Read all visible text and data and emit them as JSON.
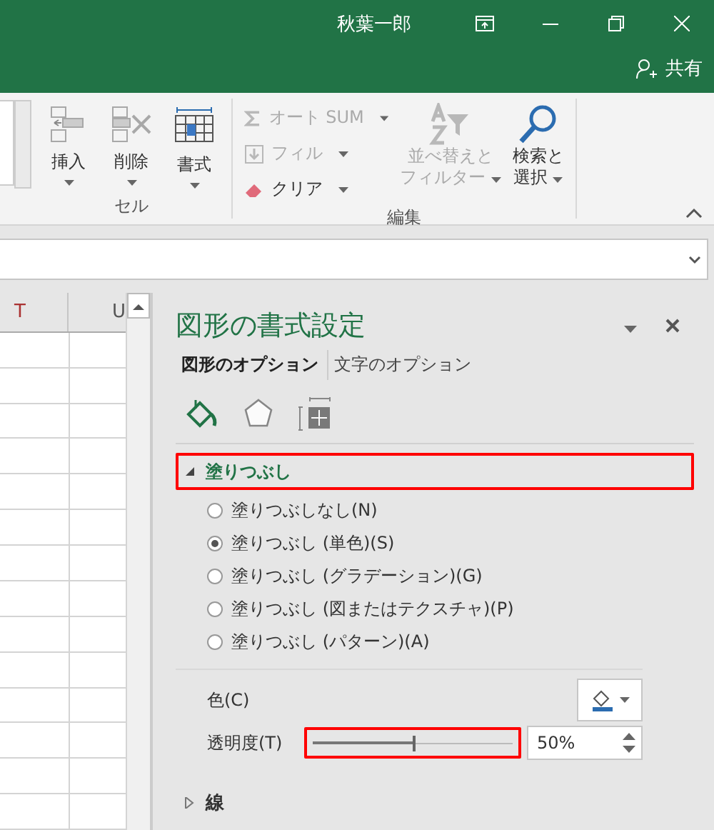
{
  "title_bar": {
    "user": "秋葉一郎",
    "share": "共有"
  },
  "ribbon": {
    "cells_group": {
      "label": "セル",
      "buttons": [
        {
          "label": "挿入"
        },
        {
          "label": "削除"
        },
        {
          "label": "書式"
        }
      ]
    },
    "edit_group": {
      "label": "編集",
      "small_buttons": [
        {
          "label": "オート SUM",
          "disabled": true
        },
        {
          "label": "フィル",
          "disabled": true
        },
        {
          "label": "クリア",
          "disabled": false
        }
      ],
      "large_buttons": [
        {
          "lines": [
            "並べ替えと",
            "フィルター"
          ],
          "disabled": true
        },
        {
          "lines": [
            "検索と",
            "選択"
          ],
          "disabled": false
        }
      ]
    }
  },
  "sheet": {
    "columns": [
      {
        "label": "T"
      },
      {
        "label": "U"
      }
    ]
  },
  "pane": {
    "title": "図形の書式設定",
    "tabs": [
      {
        "label": "図形のオプション",
        "selected": true
      },
      {
        "label": "文字のオプション",
        "selected": false
      }
    ],
    "icon_tabs": [
      {
        "selected": true
      },
      {
        "selected": false
      },
      {
        "selected": false
      }
    ],
    "sections": [
      {
        "title": "塗りつぶし",
        "expanded": true,
        "highlighted": true,
        "options": [
          {
            "label": "塗りつぶしなし(N)",
            "selected": false
          },
          {
            "label": "塗りつぶし (単色)(S)",
            "selected": true
          },
          {
            "label": "塗りつぶし (グラデーション)(G)",
            "selected": false
          },
          {
            "label": "塗りつぶし (図またはテクスチャ)(P)",
            "selected": false
          },
          {
            "label": "塗りつぶし (パターン)(A)",
            "selected": false
          }
        ],
        "color_label": "色(C)",
        "transparency": {
          "label": "透明度(T)",
          "level": 0.5,
          "highlighted": true,
          "reading": "50%"
        }
      },
      {
        "title": "線",
        "expanded": false,
        "highlighted": false
      }
    ]
  }
}
